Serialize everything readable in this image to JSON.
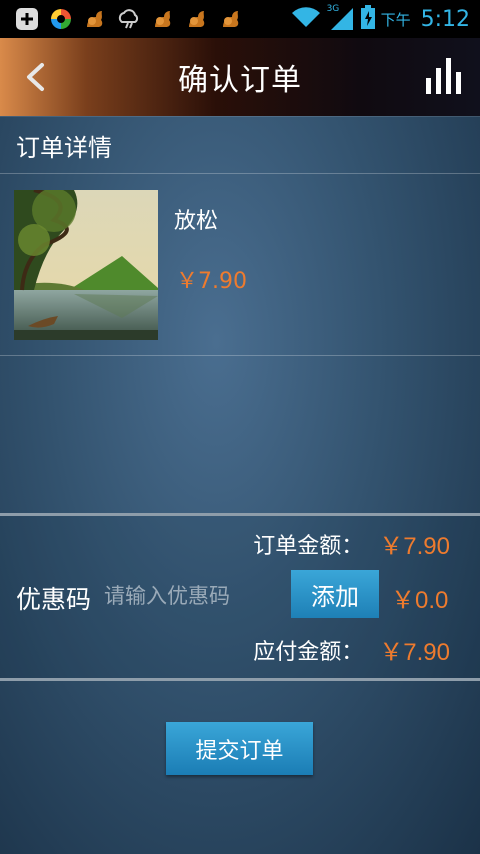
{
  "status_bar": {
    "ampm": "下午",
    "time": "5:12",
    "network": "3G",
    "icons": [
      "add-icon",
      "colorful-app-icon",
      "squirrel-icon",
      "weather-icon",
      "squirrel-icon",
      "squirrel-icon",
      "squirrel-icon",
      "wifi-icon",
      "signal-icon",
      "battery-icon"
    ]
  },
  "header": {
    "title": "确认订单",
    "back_icon": "chevron-left-icon",
    "stats_icon": "bar-chart-icon"
  },
  "section": {
    "title": "订单详情"
  },
  "item": {
    "name": "放松",
    "price": "￥7.90"
  },
  "summary": {
    "order_amount_label": "订单金额：",
    "order_amount": "￥7.90",
    "coupon_label": "优惠码",
    "coupon_placeholder": "请输入优惠码",
    "add_label": "添加",
    "discount": "￥0.0",
    "payable_label": "应付金额：",
    "payable_amount": "￥7.90"
  },
  "submit": {
    "label": "提交订单"
  },
  "colors": {
    "accent": "#ee7b2e",
    "button": "#2a93c9",
    "status": "#33b5e5"
  }
}
